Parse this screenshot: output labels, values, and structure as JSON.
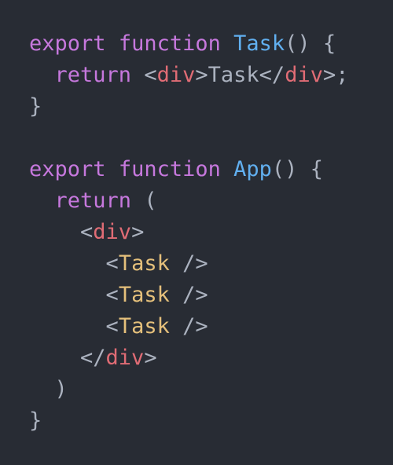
{
  "code": {
    "kw_export": "export",
    "kw_function": "function",
    "kw_return": "return",
    "fn_task": "Task",
    "fn_app": "App",
    "tag_div": "div",
    "comp_task": "Task",
    "jsx_text_task": "Task",
    "parens": "()",
    "open_brace": "{",
    "close_brace": "}",
    "open_paren": "(",
    "close_paren": ")",
    "lt": "<",
    "gt": ">",
    "lt_slash": "</",
    "self_close": "/>",
    "semicolon_gt": ">;"
  },
  "colors": {
    "background": "#282c34",
    "keyword": "#c678dd",
    "function_name": "#61afef",
    "punctuation": "#abb2bf",
    "html_tag": "#e06c75",
    "component_tag": "#e5c07b"
  }
}
